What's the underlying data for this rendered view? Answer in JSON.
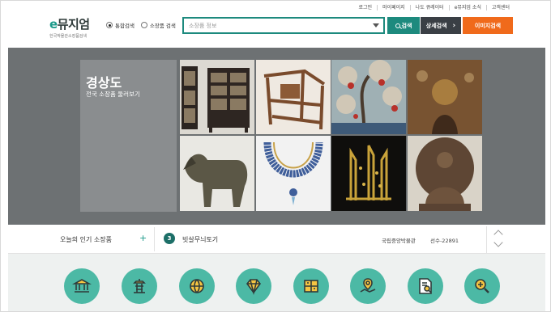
{
  "top_links": [
    "로그인",
    "마이페이지",
    "나도 큐레이터",
    "e뮤지엄 소식",
    "고객센터"
  ],
  "logo": {
    "title_e": "e",
    "title_rest": "뮤지엄",
    "subtitle": "한국박물관소장품검색"
  },
  "search_scope": {
    "options": [
      "통합검색",
      "소장품 검색"
    ],
    "selected": "통합검색"
  },
  "search": {
    "placeholder": "소장품 정보"
  },
  "buttons": {
    "search": "검색",
    "advanced": "상세검색",
    "advanced_arrow": "›",
    "image": "이미지검색"
  },
  "banner": {
    "region_title": "경상도",
    "region_subtitle": "전국 소장품 둘러보기"
  },
  "popular": {
    "label": "오늘의 인기 소장품",
    "plus": "+",
    "rank": "3",
    "item": "빗살무늬토기",
    "museum": "국립중앙박물관",
    "id": "선수-22891"
  },
  "categories": [
    {
      "icon": "museum-icon",
      "color": "#4cb9a5"
    },
    {
      "icon": "pagoda-icon",
      "color": "#4cb9a5"
    },
    {
      "icon": "globe-icon",
      "color": "#4cb9a5"
    },
    {
      "icon": "diamond-icon",
      "color": "#4cb9a5"
    },
    {
      "icon": "shelf-icon",
      "color": "#4cb9a5"
    },
    {
      "icon": "map-pin-icon",
      "color": "#4cb9a5"
    },
    {
      "icon": "document-search-icon",
      "color": "#4cb9a5"
    },
    {
      "icon": "zoom-in-icon",
      "color": "#4cb9a5"
    }
  ],
  "colors": {
    "accent": "#1d8a7e",
    "dark_button": "#3a3f45",
    "orange_button": "#f06a1b",
    "icon_circle": "#4cb9a5"
  }
}
